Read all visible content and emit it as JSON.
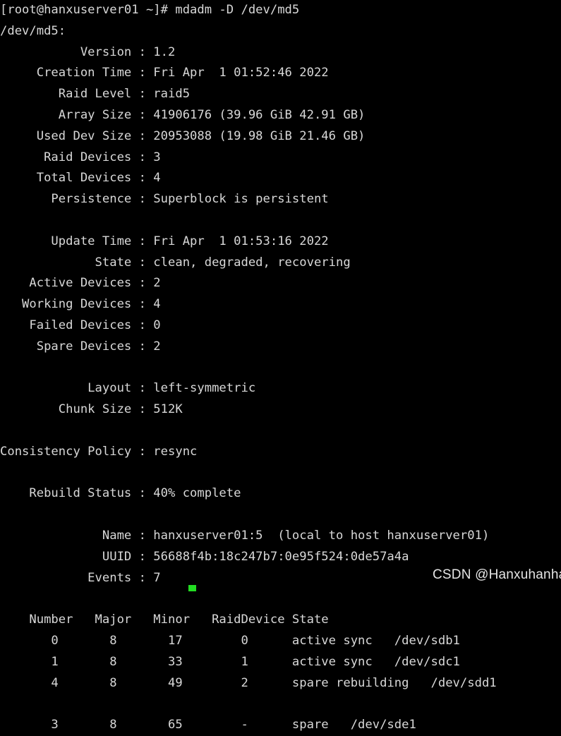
{
  "terminal": {
    "title": "mdadm -D /dev/md5",
    "background_color": "#000000",
    "foreground_color": "#d8d8d8",
    "cursor_color": "#22dd22",
    "prompt": "[root@hanxuserver01 ~]#",
    "command": "mdadm -D /dev/md5",
    "prompt_line": "[root@hanxuserver01 ~]# mdadm -D /dev/md5",
    "lines": [
      "[root@hanxuserver01 ~]# mdadm -D /dev/md5",
      "/dev/md5:",
      "           Version : 1.2",
      "     Creation Time : Fri Apr  1 01:52:46 2022",
      "        Raid Level : raid5",
      "        Array Size : 41906176 (39.96 GiB 42.91 GB)",
      "     Used Dev Size : 20953088 (19.98 GiB 21.46 GB)",
      "      Raid Devices : 3",
      "     Total Devices : 4",
      "       Persistence : Superblock is persistent",
      "",
      "       Update Time : Fri Apr  1 01:53:16 2022",
      "             State : clean, degraded, recovering",
      "    Active Devices : 2",
      "   Working Devices : 4",
      "    Failed Devices : 0",
      "     Spare Devices : 2",
      "",
      "            Layout : left-symmetric",
      "        Chunk Size : 512K",
      "",
      "Consistency Policy : resync",
      "",
      "    Rebuild Status : 40% complete",
      "",
      "              Name : hanxuserver01:5  (local to host hanxuserver01)",
      "              UUID : 56688f4b:18c247b7:0e95f524:0de57a4a",
      "            Events : 7",
      "",
      "    Number   Major   Minor   RaidDevice State",
      "       0       8       17        0      active sync   /dev/sdb1",
      "       1       8       33        1      active sync   /dev/sdc1",
      "       4       8       49        2      spare rebuilding   /dev/sdd1",
      "",
      "       3       8       65        -      spare   /dev/sde1"
    ]
  },
  "array_detail": {
    "device": "/dev/md5",
    "fields": [
      {
        "label": "Version",
        "value": "1.2"
      },
      {
        "label": "Creation Time",
        "value": "Fri Apr  1 01:52:46 2022"
      },
      {
        "label": "Raid Level",
        "value": "raid5"
      },
      {
        "label": "Array Size",
        "value": "41906176 (39.96 GiB 42.91 GB)"
      },
      {
        "label": "Used Dev Size",
        "value": "20953088 (19.98 GiB 21.46 GB)"
      },
      {
        "label": "Raid Devices",
        "value": "3"
      },
      {
        "label": "Total Devices",
        "value": "4"
      },
      {
        "label": "Persistence",
        "value": "Superblock is persistent"
      },
      {
        "label": "Update Time",
        "value": "Fri Apr  1 01:53:16 2022"
      },
      {
        "label": "State",
        "value": "clean, degraded, recovering"
      },
      {
        "label": "Active Devices",
        "value": "2"
      },
      {
        "label": "Working Devices",
        "value": "4"
      },
      {
        "label": "Failed Devices",
        "value": "0"
      },
      {
        "label": "Spare Devices",
        "value": "2"
      },
      {
        "label": "Layout",
        "value": "left-symmetric"
      },
      {
        "label": "Chunk Size",
        "value": "512K"
      },
      {
        "label": "Consistency Policy",
        "value": "resync"
      },
      {
        "label": "Rebuild Status",
        "value": "40% complete"
      },
      {
        "label": "Name",
        "value": "hanxuserver01:5  (local to host hanxuserver01)"
      },
      {
        "label": "UUID",
        "value": "56688f4b:18c247b7:0e95f524:0de57a4a"
      },
      {
        "label": "Events",
        "value": "7"
      }
    ],
    "rebuild_percent": 40
  },
  "device_table": {
    "headers": [
      "Number",
      "Major",
      "Minor",
      "RaidDevice",
      "State"
    ],
    "rows": [
      {
        "number": "0",
        "major": "8",
        "minor": "17",
        "raiddevice": "0",
        "state": "active sync",
        "path": "/dev/sdb1"
      },
      {
        "number": "1",
        "major": "8",
        "minor": "33",
        "raiddevice": "1",
        "state": "active sync",
        "path": "/dev/sdc1"
      },
      {
        "number": "4",
        "major": "8",
        "minor": "49",
        "raiddevice": "2",
        "state": "spare rebuilding",
        "path": "/dev/sdd1"
      },
      {
        "number": "3",
        "major": "8",
        "minor": "65",
        "raiddevice": "-",
        "state": "spare",
        "path": "/dev/sde1"
      }
    ]
  },
  "watermark": {
    "text": "CSDN @Hanxuhanhan"
  }
}
